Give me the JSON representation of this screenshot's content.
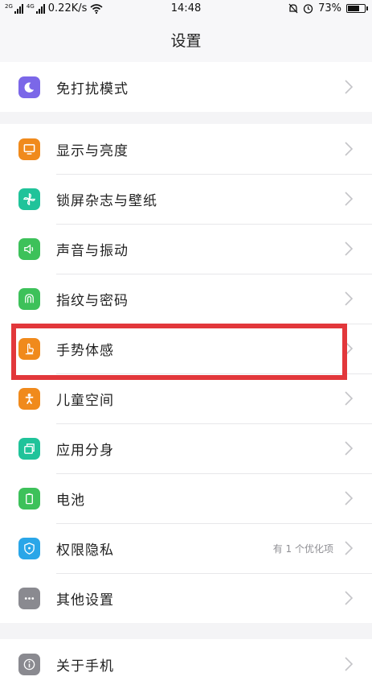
{
  "status_bar": {
    "signal1_tag": "2G",
    "signal2_tag": "4G",
    "speed": "0.22K/s",
    "time": "14:48",
    "battery": "73%",
    "battery_level": 0.73
  },
  "header": {
    "title": "设置"
  },
  "groups": [
    {
      "items": [
        {
          "label": "免打扰模式",
          "icon": "moon-icon",
          "color": "#7b67e8"
        }
      ]
    },
    {
      "items": [
        {
          "label": "显示与亮度",
          "icon": "display-icon",
          "color": "#f08a1c"
        },
        {
          "label": "锁屏杂志与壁纸",
          "icon": "pinwheel-icon",
          "color": "#20c39a"
        },
        {
          "label": "声音与振动",
          "icon": "speaker-icon",
          "color": "#3dc15a"
        },
        {
          "label": "指纹与密码",
          "icon": "fingerprint-icon",
          "color": "#3dc15a"
        },
        {
          "label": "手势体感",
          "icon": "gesture-hand-icon",
          "color": "#f08a1c"
        },
        {
          "label": "儿童空间",
          "icon": "child-icon",
          "color": "#f08a1c"
        },
        {
          "label": "应用分身",
          "icon": "app-clone-icon",
          "color": "#20c39a"
        },
        {
          "label": "电池",
          "icon": "battery-icon",
          "color": "#3dc15a"
        },
        {
          "label": "权限隐私",
          "icon": "shield-icon",
          "color": "#2aa6e8",
          "hint": "有 1 个优化项"
        },
        {
          "label": "其他设置",
          "icon": "more-icon",
          "color": "#8a8a90"
        }
      ]
    },
    {
      "items": [
        {
          "label": "关于手机",
          "icon": "info-icon",
          "color": "#8a8a90"
        }
      ]
    }
  ]
}
